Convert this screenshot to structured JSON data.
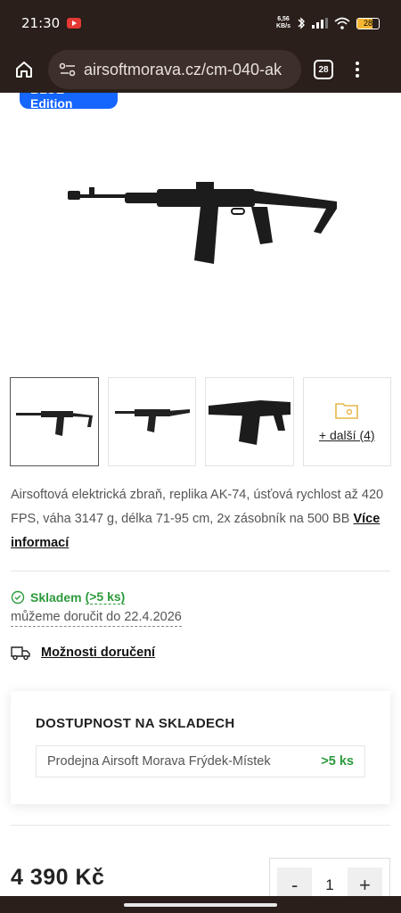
{
  "status_bar": {
    "time": "21:30",
    "net_speed_value": "6,56",
    "net_speed_unit": "KB/s",
    "battery": "28",
    "colors": {
      "background": "#2a1f1a",
      "battery": "#f5b733"
    }
  },
  "browser": {
    "url": "airsoftmorava.cz/cm-040-ak",
    "tab_count": "28"
  },
  "product": {
    "badge": "BLUE Edition",
    "gallery": {
      "more_label": "+ další (4)"
    },
    "description": "Airsoftová elektrická zbraň, replika AK-74, úsťová rychlost až 420 FPS, váha 3147 g, délka 71-95 cm, 2x zásobník na 500 BB",
    "more_info_label": "Více informací",
    "stock": {
      "status": "Skladem",
      "count": "(>5 ks)",
      "delivery": "můžeme doručit do 22.4.2026"
    },
    "delivery_options_label": "Možnosti doručení",
    "availability": {
      "heading": "DOSTUPNOST NA SKLADECH",
      "stores": [
        {
          "name": "Prodejna Airsoft Morava Frýdek-Místek",
          "qty": ">5 ks"
        }
      ]
    },
    "price": "4 390 Kč",
    "quantity": {
      "minus": "-",
      "value": "1",
      "plus": "+"
    }
  },
  "colors": {
    "accent_blue": "#1565ff",
    "in_stock_green": "#2c9a3b",
    "folder_icon": "#e6b84a"
  }
}
